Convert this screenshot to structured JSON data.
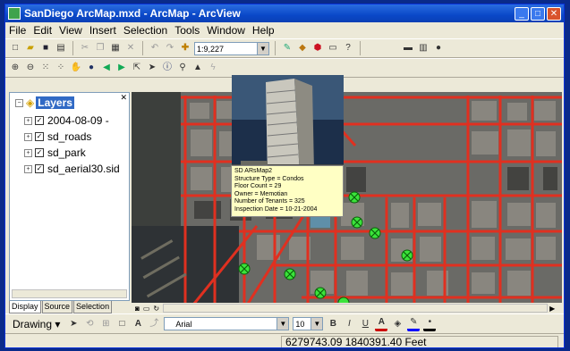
{
  "window": {
    "title": "SanDiego ArcMap.mxd - ArcMap - ArcView",
    "min": "_",
    "max": "□",
    "close": "✕"
  },
  "menu": [
    "File",
    "Edit",
    "View",
    "Insert",
    "Selection",
    "Tools",
    "Window",
    "Help"
  ],
  "toolbar": {
    "scale": "1:9,227"
  },
  "toc": {
    "root": "Layers",
    "layers": [
      "2004-08-09 -",
      "sd_roads",
      "sd_park",
      "sd_aerial30.sid"
    ],
    "tabs": [
      "Display",
      "Source",
      "Selection"
    ]
  },
  "tooltip": {
    "lines": [
      "SD ARsMap2",
      "Structure Type = Condos",
      "Floor Count = 29",
      "Owner = Memotian",
      "Number of Tenants = 325",
      "Inspection Date = 10-21-2004"
    ]
  },
  "drawing": {
    "label": "Drawing ▾",
    "font": "Arial",
    "size": "10",
    "bold": "B",
    "italic": "I",
    "underline": "U",
    "fontcolor": "A"
  },
  "status": {
    "coords": "6279743.09  1840391.40 Feet"
  },
  "colors": {
    "title": "#0a48c8",
    "roads": "#e03020",
    "points": "#33dd33",
    "tooltip": "#ffffc4"
  }
}
